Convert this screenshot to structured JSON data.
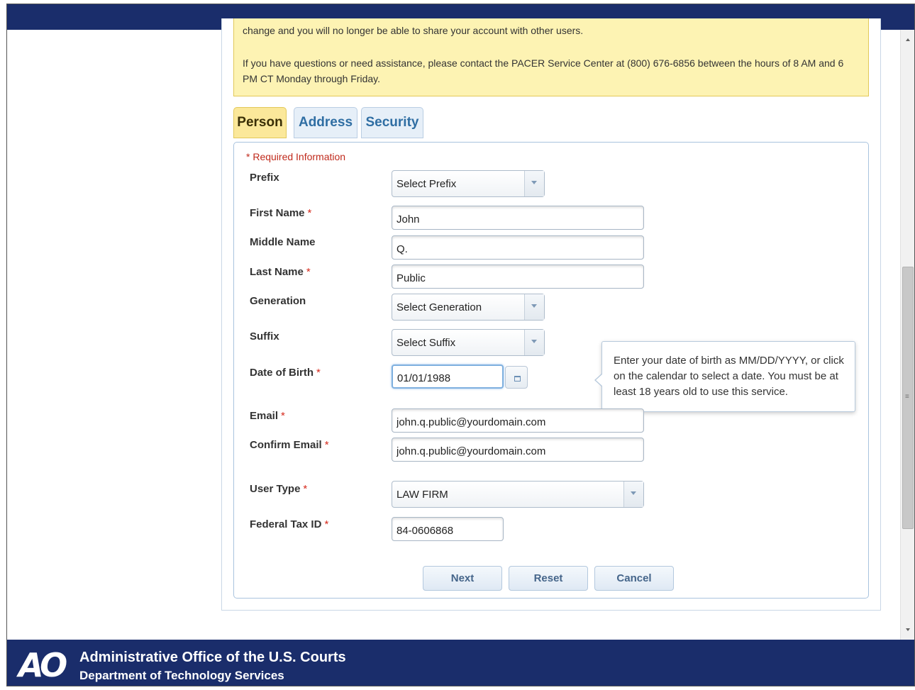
{
  "notice": {
    "cut_text": "change and you will no longer be able to share your account with other users.",
    "message": "If you have questions or need assistance, please contact the PACER Service Center at (800) 676-6856 between the hours of 8 AM and 6 PM CT Monday through Friday."
  },
  "tabs": [
    {
      "label": "Person",
      "active": true
    },
    {
      "label": "Address",
      "active": false
    },
    {
      "label": "Security",
      "active": false
    }
  ],
  "form": {
    "required_note": "* Required Information",
    "required_marker": "*",
    "labels": {
      "prefix": "Prefix",
      "first_name": "First Name",
      "middle_name": "Middle Name",
      "last_name": "Last Name",
      "generation": "Generation",
      "suffix": "Suffix",
      "dob": "Date of Birth",
      "email": "Email",
      "confirm_email": "Confirm Email",
      "user_type": "User Type",
      "tax_id": "Federal Tax ID"
    },
    "values": {
      "prefix": "Select Prefix",
      "first_name": "John",
      "middle_name": "Q.",
      "last_name": "Public",
      "generation": "Select Generation",
      "suffix": "Select Suffix",
      "dob": "01/01/1988",
      "email": "john.q.public@yourdomain.com",
      "confirm_email": "john.q.public@yourdomain.com",
      "user_type": "LAW FIRM",
      "tax_id": "84-0606868"
    },
    "tooltip": "Enter your date of birth as MM/DD/YYYY, or click on the calendar to select a date. You must be at least 18 years old to use this service."
  },
  "buttons": {
    "next": "Next",
    "reset": "Reset",
    "cancel": "Cancel"
  },
  "footer": {
    "logo": "AO",
    "line1": "Administrative Office of the U.S. Courts",
    "line2": "Department of Technology Services"
  },
  "colors": {
    "header_blue": "#1a2d6b",
    "notice_yellow": "#fdf3b3",
    "required_red": "#c02a1c",
    "tab_active": "#fbe89a",
    "tab_inactive_text": "#2f6ea3"
  },
  "icons": [
    "calendar-icon",
    "chevron-down-icon",
    "scroll-up-icon",
    "scroll-down-icon"
  ]
}
